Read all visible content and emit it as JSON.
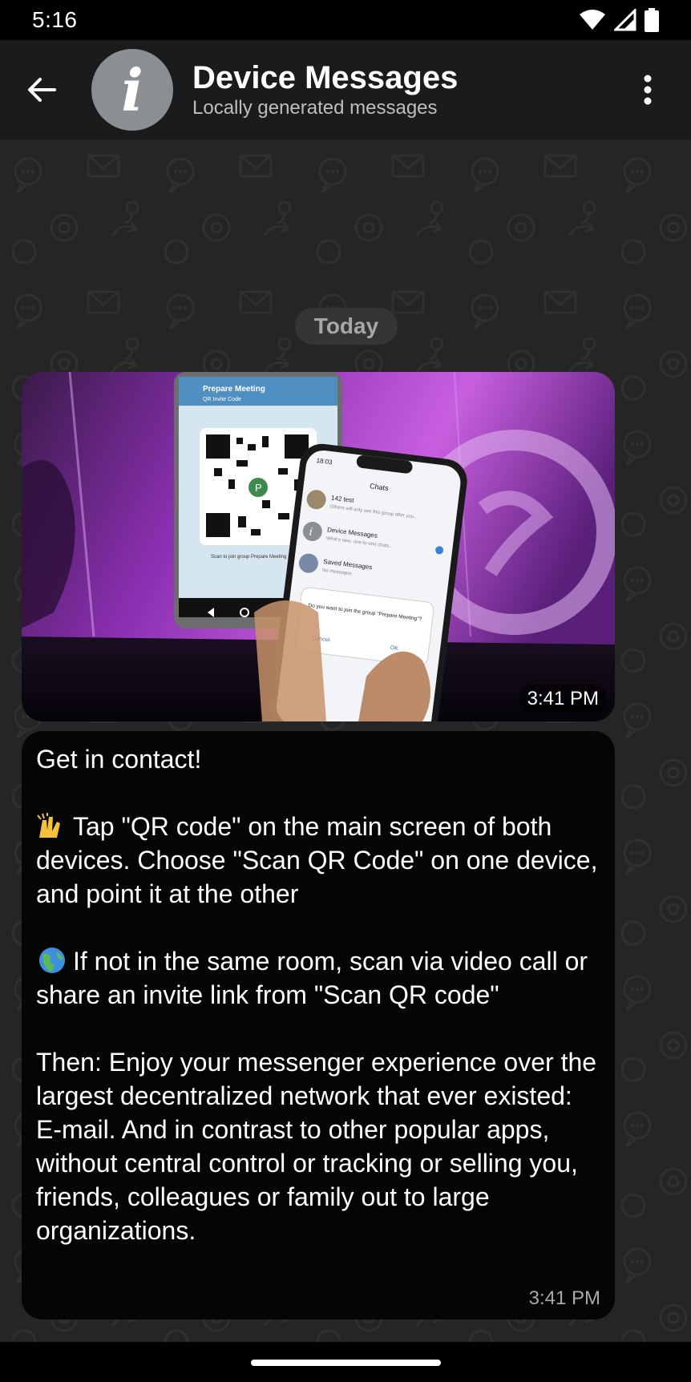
{
  "status_bar": {
    "time": "5:16",
    "icons": [
      "wifi-icon",
      "signal-icon",
      "battery-icon"
    ]
  },
  "app_bar": {
    "back_icon": "arrow-left-icon",
    "avatar_letter": "i",
    "title": "Device Messages",
    "subtitle": "Locally generated messages",
    "menu_icon": "more-vertical-icon"
  },
  "chat": {
    "day_label": "Today",
    "image_message": {
      "time": "3:41 PM",
      "content": "photo of two phones showing QR code invite",
      "screen_texts": {
        "phone_back_title": "Prepare Meeting",
        "phone_back_subtitle": "QR Invite Code",
        "phone_back_caption": "Scan to join group Prepare Meeting",
        "phone_front_time": "18:03",
        "phone_front_header": "Chats",
        "chat_rows": [
          {
            "name": "142 test",
            "preview": "Others will only see this group after you..."
          },
          {
            "name": "Device Messages",
            "preview": "What's new: one-to-one chats..."
          },
          {
            "name": "Saved Messages",
            "preview": "No messages."
          }
        ],
        "dialog_text": "Do you want to join the group \"Prepare Meeting\"?",
        "dialog_cancel": "Cancel",
        "dialog_ok": "OK"
      }
    },
    "text_message": {
      "time": "3:41 PM",
      "paragraphs": [
        "Get in contact!",
        "Tap \"QR code\" on the main screen of both devices. Choose \"Scan QR Code\" on one device, and point it at the other",
        "If not in the same room, scan via video call or share an invite link from \"Scan QR code\"",
        "Then: Enjoy your messenger experience over the largest decentralized network that ever existed: E-mail. And in contrast to other popular apps, without central control or tracking or selling you, friends, colleagues or family out to large organizations."
      ],
      "emojis": [
        "raising-hands-emoji",
        "globe-emoji"
      ]
    }
  },
  "colors": {
    "app_bar": "#1b1b1b",
    "chat_background": "#252525",
    "bubble": "#050505",
    "avatar": "#8a8f94",
    "accent_purple": "#b04fd6"
  }
}
